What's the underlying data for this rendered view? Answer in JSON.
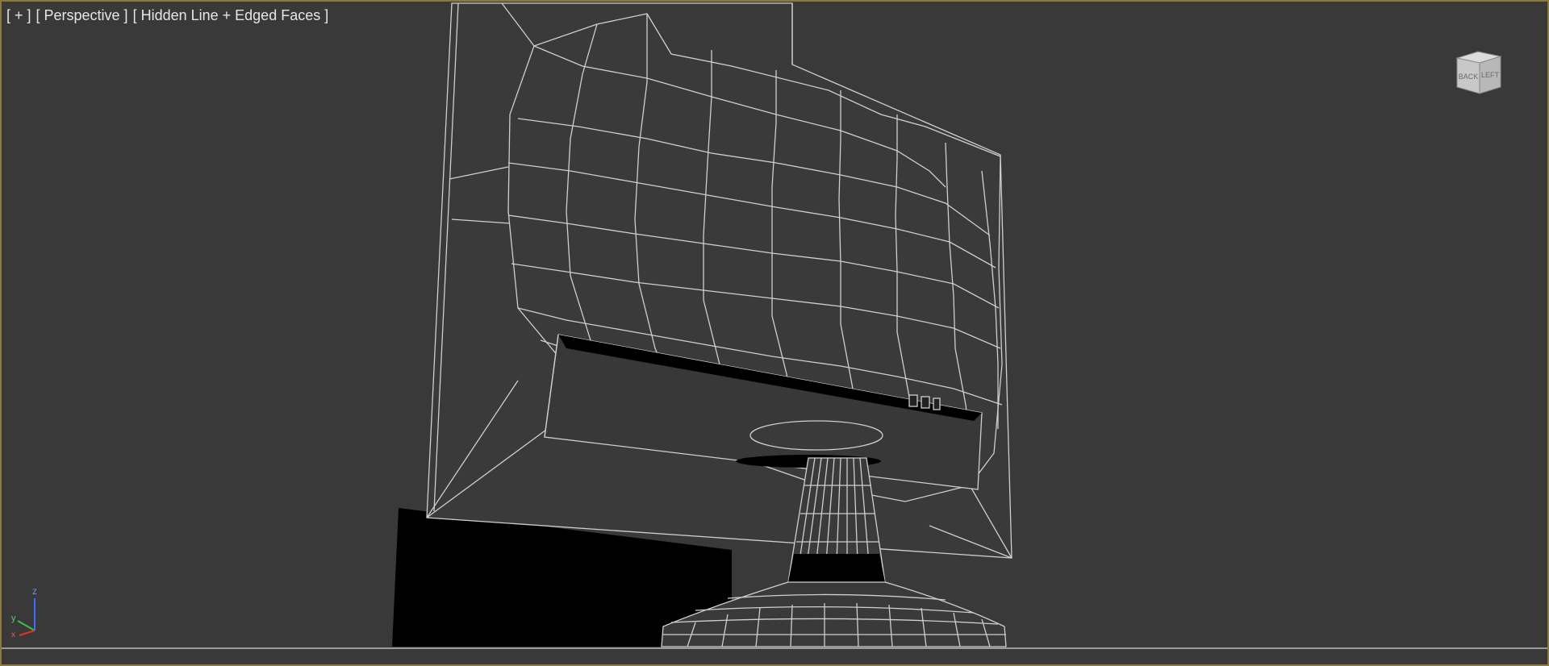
{
  "viewport": {
    "label_plus": "[ + ]",
    "label_view": "[ Perspective ]",
    "label_shading": "[ Hidden Line + Edged Faces ]",
    "border_color": "#8a7a3c",
    "background_color": "#393939"
  },
  "viewcube": {
    "face_left": "BACK",
    "face_right": "LEFT",
    "icon": "viewcube-icon"
  },
  "axis_gizmo": {
    "z_label": "z",
    "y_label": "y",
    "x_label": "x"
  },
  "scene": {
    "object": "monitor-back-wireframe",
    "wire_color": "#cfcfcf",
    "shadow_color": "#000000"
  }
}
